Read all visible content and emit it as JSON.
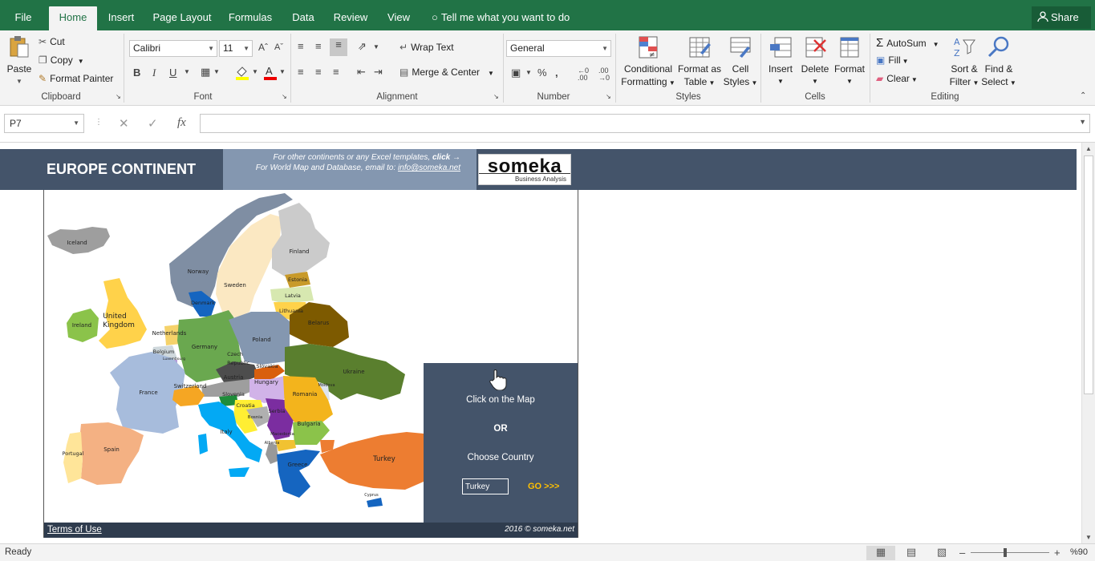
{
  "tabs": [
    {
      "label": "File",
      "active": false
    },
    {
      "label": "Home",
      "active": true
    },
    {
      "label": "Insert",
      "active": false
    },
    {
      "label": "Page Layout",
      "active": false
    },
    {
      "label": "Formulas",
      "active": false
    },
    {
      "label": "Data",
      "active": false
    },
    {
      "label": "Review",
      "active": false
    },
    {
      "label": "View",
      "active": false
    }
  ],
  "tell_me": "Tell me what you want to do",
  "share": "Share",
  "ribbon": {
    "clipboard": {
      "paste": "Paste",
      "cut": "Cut",
      "copy": "Copy",
      "format_painter": "Format Painter",
      "label": "Clipboard"
    },
    "font": {
      "name": "Calibri",
      "size": "11",
      "bold": "B",
      "italic": "I",
      "underline": "U",
      "label": "Font"
    },
    "alignment": {
      "wrap": "Wrap Text",
      "merge": "Merge & Center",
      "label": "Alignment"
    },
    "number": {
      "format": "General",
      "label": "Number"
    },
    "styles": {
      "conditional_1": "Conditional",
      "conditional_2": "Formatting",
      "format_table_1": "Format as",
      "format_table_2": "Table",
      "cell_styles_1": "Cell",
      "cell_styles_2": "Styles",
      "label": "Styles"
    },
    "cells": {
      "insert": "Insert",
      "delete": "Delete",
      "format": "Format",
      "label": "Cells"
    },
    "editing": {
      "autosum": "AutoSum",
      "fill": "Fill",
      "clear": "Clear",
      "sort_1": "Sort &",
      "sort_2": "Filter",
      "find_1": "Find &",
      "find_2": "Select",
      "label": "Editing"
    }
  },
  "formula_bar": {
    "name_box": "P7",
    "formula": ""
  },
  "sheet": {
    "title": "EUROPE CONTINENT",
    "info_line1": "For other continents or any Excel templates,",
    "info_click": "click →",
    "info_line2": "For World Map and Database, email to:",
    "info_email": "info@someka.net",
    "logo_name": "someka",
    "logo_sub": "Business Analysis",
    "footer_left": "Terms of Use",
    "footer_right": "2016 © someka.net",
    "countries": {
      "iceland": "Iceland",
      "norway": "Norway",
      "sweden": "Sweden",
      "finland": "Finland",
      "estonia": "Estonia",
      "latvia": "Latvia",
      "lithuania": "Lithuania",
      "belarus": "Belarus",
      "denmark": "Denmark",
      "uk_1": "United",
      "uk_2": "Kingdom",
      "ireland": "Ireland",
      "netherlands": "Netherlands",
      "belgium": "Belgium",
      "luxembourg": "Luxembourg",
      "germany": "Germany",
      "poland": "Poland",
      "czech_1": "Czech",
      "czech_2": "Republic",
      "slovakia": "Slovakia",
      "ukraine": "Ukraine",
      "moldova": "Moldova",
      "austria": "Austria",
      "hungary": "Hungary",
      "switzerland": "Switzerland",
      "france": "France",
      "slovenia": "Slovenia",
      "croatia": "Croatia",
      "bosnia": "Bosnia",
      "serbia": "Serbia",
      "romania": "Romania",
      "bulgaria": "Bulgaria",
      "macedonia": "Macedonia",
      "albania": "Albania",
      "greece": "Greece",
      "italy": "Italy",
      "spain": "Spain",
      "portugal": "Portugal",
      "turkey": "Turkey",
      "cyprus": "Cyprus"
    },
    "panel": {
      "click": "Click on the Map",
      "or": "OR",
      "choose": "Choose Country",
      "selected": "Turkey",
      "go": "GO >>>"
    }
  },
  "status": {
    "ready": "Ready",
    "zoom": "%90"
  }
}
